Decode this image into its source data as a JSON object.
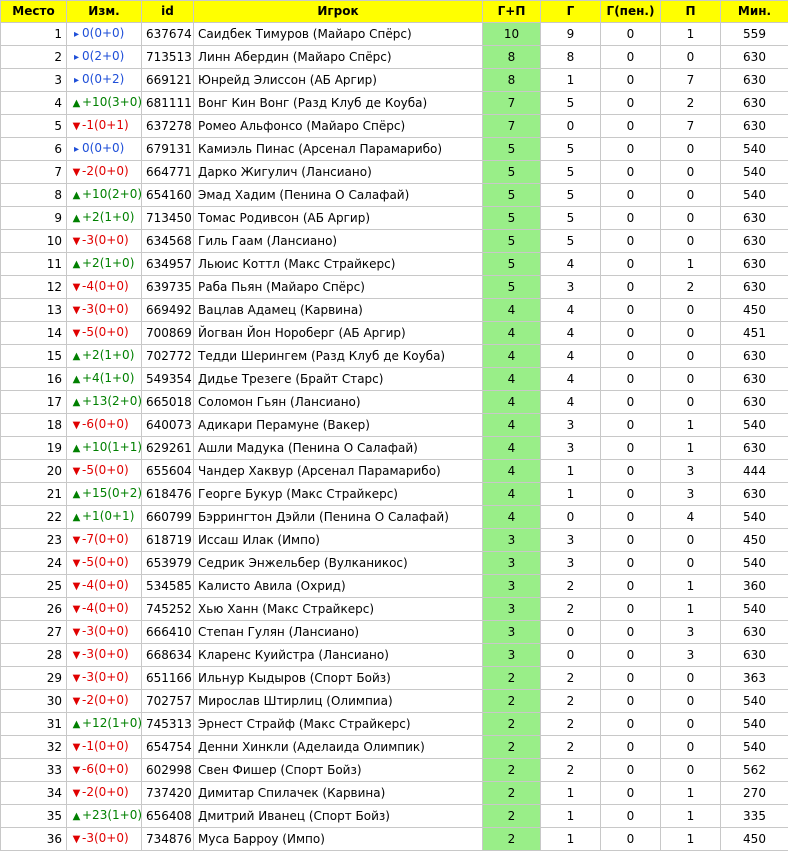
{
  "colors": {
    "header_bg": "#ffff00",
    "gp_highlight": "#99ee88",
    "up": "#008000",
    "down": "#e00000",
    "same": "#1f4fd8",
    "grid": "#c8c8c8"
  },
  "headers": [
    "Место",
    "Изм.",
    "id",
    "Игрок",
    "Г+П",
    "Г",
    "Г(пен.)",
    "П",
    "Мин."
  ],
  "rows": [
    {
      "rank": "1",
      "dir": "same",
      "chg": "0(0+0)",
      "id": "637674",
      "player": "Саидбек Тимуров (Майаро Спёрс)",
      "gp": "10",
      "g": "9",
      "pen": "0",
      "a": "1",
      "min": "559"
    },
    {
      "rank": "2",
      "dir": "same",
      "chg": "0(2+0)",
      "id": "713513",
      "player": "Линн Абердин (Майаро Спёрс)",
      "gp": "8",
      "g": "8",
      "pen": "0",
      "a": "0",
      "min": "630"
    },
    {
      "rank": "3",
      "dir": "same",
      "chg": "0(0+2)",
      "id": "669121",
      "player": "Юнрейд Элиссон (АБ Аргир)",
      "gp": "8",
      "g": "1",
      "pen": "0",
      "a": "7",
      "min": "630"
    },
    {
      "rank": "4",
      "dir": "up",
      "chg": "+10(3+0)",
      "id": "681111",
      "player": "Вонг Кин Вонг (Разд Клуб де Коуба)",
      "gp": "7",
      "g": "5",
      "pen": "0",
      "a": "2",
      "min": "630"
    },
    {
      "rank": "5",
      "dir": "down",
      "chg": "-1(0+1)",
      "id": "637278",
      "player": "Ромео Альфонсо (Майаро Спёрс)",
      "gp": "7",
      "g": "0",
      "pen": "0",
      "a": "7",
      "min": "630"
    },
    {
      "rank": "6",
      "dir": "same",
      "chg": "0(0+0)",
      "id": "679131",
      "player": "Камиэль Пинас (Арсенал Парамарибо)",
      "gp": "5",
      "g": "5",
      "pen": "0",
      "a": "0",
      "min": "540"
    },
    {
      "rank": "7",
      "dir": "down",
      "chg": "-2(0+0)",
      "id": "664771",
      "player": "Дарко Жигулич (Лансиано)",
      "gp": "5",
      "g": "5",
      "pen": "0",
      "a": "0",
      "min": "540"
    },
    {
      "rank": "8",
      "dir": "up",
      "chg": "+10(2+0)",
      "id": "654160",
      "player": "Эмад Хадим (Пенина О Салафай)",
      "gp": "5",
      "g": "5",
      "pen": "0",
      "a": "0",
      "min": "540"
    },
    {
      "rank": "9",
      "dir": "up",
      "chg": "+2(1+0)",
      "id": "713450",
      "player": "Томас Родивсон (АБ Аргир)",
      "gp": "5",
      "g": "5",
      "pen": "0",
      "a": "0",
      "min": "630"
    },
    {
      "rank": "10",
      "dir": "down",
      "chg": "-3(0+0)",
      "id": "634568",
      "player": "Гиль Гаам (Лансиано)",
      "gp": "5",
      "g": "5",
      "pen": "0",
      "a": "0",
      "min": "630"
    },
    {
      "rank": "11",
      "dir": "up",
      "chg": "+2(1+0)",
      "id": "634957",
      "player": "Льюис Коттл (Макс Страйкерс)",
      "gp": "5",
      "g": "4",
      "pen": "0",
      "a": "1",
      "min": "630"
    },
    {
      "rank": "12",
      "dir": "down",
      "chg": "-4(0+0)",
      "id": "639735",
      "player": "Раба Пьян (Майаро Спёрс)",
      "gp": "5",
      "g": "3",
      "pen": "0",
      "a": "2",
      "min": "630"
    },
    {
      "rank": "13",
      "dir": "down",
      "chg": "-3(0+0)",
      "id": "669492",
      "player": "Вацлав Адамец (Карвина)",
      "gp": "4",
      "g": "4",
      "pen": "0",
      "a": "0",
      "min": "450"
    },
    {
      "rank": "14",
      "dir": "down",
      "chg": "-5(0+0)",
      "id": "700869",
      "player": "Йогван Йон Нороберг (АБ Аргир)",
      "gp": "4",
      "g": "4",
      "pen": "0",
      "a": "0",
      "min": "451"
    },
    {
      "rank": "15",
      "dir": "up",
      "chg": "+2(1+0)",
      "id": "702772",
      "player": "Тедди Шерингем (Разд Клуб де Коуба)",
      "gp": "4",
      "g": "4",
      "pen": "0",
      "a": "0",
      "min": "630"
    },
    {
      "rank": "16",
      "dir": "up",
      "chg": "+4(1+0)",
      "id": "549354",
      "player": "Дидье Трезеге (Брайт Старс)",
      "gp": "4",
      "g": "4",
      "pen": "0",
      "a": "0",
      "min": "630"
    },
    {
      "rank": "17",
      "dir": "up",
      "chg": "+13(2+0)",
      "id": "665018",
      "player": "Соломон Гьян (Лансиано)",
      "gp": "4",
      "g": "4",
      "pen": "0",
      "a": "0",
      "min": "630"
    },
    {
      "rank": "18",
      "dir": "down",
      "chg": "-6(0+0)",
      "id": "640073",
      "player": "Адикари Перамуне (Вакер)",
      "gp": "4",
      "g": "3",
      "pen": "0",
      "a": "1",
      "min": "540"
    },
    {
      "rank": "19",
      "dir": "up",
      "chg": "+10(1+1)",
      "id": "629261",
      "player": "Ашли Мадука (Пенина О Салафай)",
      "gp": "4",
      "g": "3",
      "pen": "0",
      "a": "1",
      "min": "630"
    },
    {
      "rank": "20",
      "dir": "down",
      "chg": "-5(0+0)",
      "id": "655604",
      "player": "Чандер Хаквур (Арсенал Парамарибо)",
      "gp": "4",
      "g": "1",
      "pen": "0",
      "a": "3",
      "min": "444"
    },
    {
      "rank": "21",
      "dir": "up",
      "chg": "+15(0+2)",
      "id": "618476",
      "player": "Георге Букур (Макс Страйкерс)",
      "gp": "4",
      "g": "1",
      "pen": "0",
      "a": "3",
      "min": "630"
    },
    {
      "rank": "22",
      "dir": "up",
      "chg": "+1(0+1)",
      "id": "660799",
      "player": "Бэррингтон Дэйли (Пенина О Салафай)",
      "gp": "4",
      "g": "0",
      "pen": "0",
      "a": "4",
      "min": "540"
    },
    {
      "rank": "23",
      "dir": "down",
      "chg": "-7(0+0)",
      "id": "618719",
      "player": "Иссаш Илак (Импо)",
      "gp": "3",
      "g": "3",
      "pen": "0",
      "a": "0",
      "min": "450"
    },
    {
      "rank": "24",
      "dir": "down",
      "chg": "-5(0+0)",
      "id": "653979",
      "player": "Седрик Энжельбер (Вулканикос)",
      "gp": "3",
      "g": "3",
      "pen": "0",
      "a": "0",
      "min": "540"
    },
    {
      "rank": "25",
      "dir": "down",
      "chg": "-4(0+0)",
      "id": "534585",
      "player": "Калисто Авила (Охрид)",
      "gp": "3",
      "g": "2",
      "pen": "0",
      "a": "1",
      "min": "360"
    },
    {
      "rank": "26",
      "dir": "down",
      "chg": "-4(0+0)",
      "id": "745252",
      "player": "Хью Ханн (Макс Страйкерс)",
      "gp": "3",
      "g": "2",
      "pen": "0",
      "a": "1",
      "min": "540"
    },
    {
      "rank": "27",
      "dir": "down",
      "chg": "-3(0+0)",
      "id": "666410",
      "player": "Степан Гулян (Лансиано)",
      "gp": "3",
      "g": "0",
      "pen": "0",
      "a": "3",
      "min": "630"
    },
    {
      "rank": "28",
      "dir": "down",
      "chg": "-3(0+0)",
      "id": "668634",
      "player": "Кларенс Куийстра (Лансиано)",
      "gp": "3",
      "g": "0",
      "pen": "0",
      "a": "3",
      "min": "630"
    },
    {
      "rank": "29",
      "dir": "down",
      "chg": "-3(0+0)",
      "id": "651166",
      "player": "Ильнур Кыдыров (Спорт Бойз)",
      "gp": "2",
      "g": "2",
      "pen": "0",
      "a": "0",
      "min": "363"
    },
    {
      "rank": "30",
      "dir": "down",
      "chg": "-2(0+0)",
      "id": "702757",
      "player": "Мирослав Штирлиц (Олимпиа)",
      "gp": "2",
      "g": "2",
      "pen": "0",
      "a": "0",
      "min": "540"
    },
    {
      "rank": "31",
      "dir": "up",
      "chg": "+12(1+0)",
      "id": "745313",
      "player": "Эрнест Страйф (Макс Страйкерс)",
      "gp": "2",
      "g": "2",
      "pen": "0",
      "a": "0",
      "min": "540"
    },
    {
      "rank": "32",
      "dir": "down",
      "chg": "-1(0+0)",
      "id": "654754",
      "player": "Денни Хинкли (Аделаида Олимпик)",
      "gp": "2",
      "g": "2",
      "pen": "0",
      "a": "0",
      "min": "540"
    },
    {
      "rank": "33",
      "dir": "down",
      "chg": "-6(0+0)",
      "id": "602998",
      "player": "Свен Фишер (Спорт Бойз)",
      "gp": "2",
      "g": "2",
      "pen": "0",
      "a": "0",
      "min": "562"
    },
    {
      "rank": "34",
      "dir": "down",
      "chg": "-2(0+0)",
      "id": "737420",
      "player": "Димитар Спилачек (Карвина)",
      "gp": "2",
      "g": "1",
      "pen": "0",
      "a": "1",
      "min": "270"
    },
    {
      "rank": "35",
      "dir": "up",
      "chg": "+23(1+0)",
      "id": "656408",
      "player": "Дмитрий Иванец (Спорт Бойз)",
      "gp": "2",
      "g": "1",
      "pen": "0",
      "a": "1",
      "min": "335"
    },
    {
      "rank": "36",
      "dir": "down",
      "chg": "-3(0+0)",
      "id": "734876",
      "player": "Муса Барроу (Импо)",
      "gp": "2",
      "g": "1",
      "pen": "0",
      "a": "1",
      "min": "450"
    }
  ]
}
